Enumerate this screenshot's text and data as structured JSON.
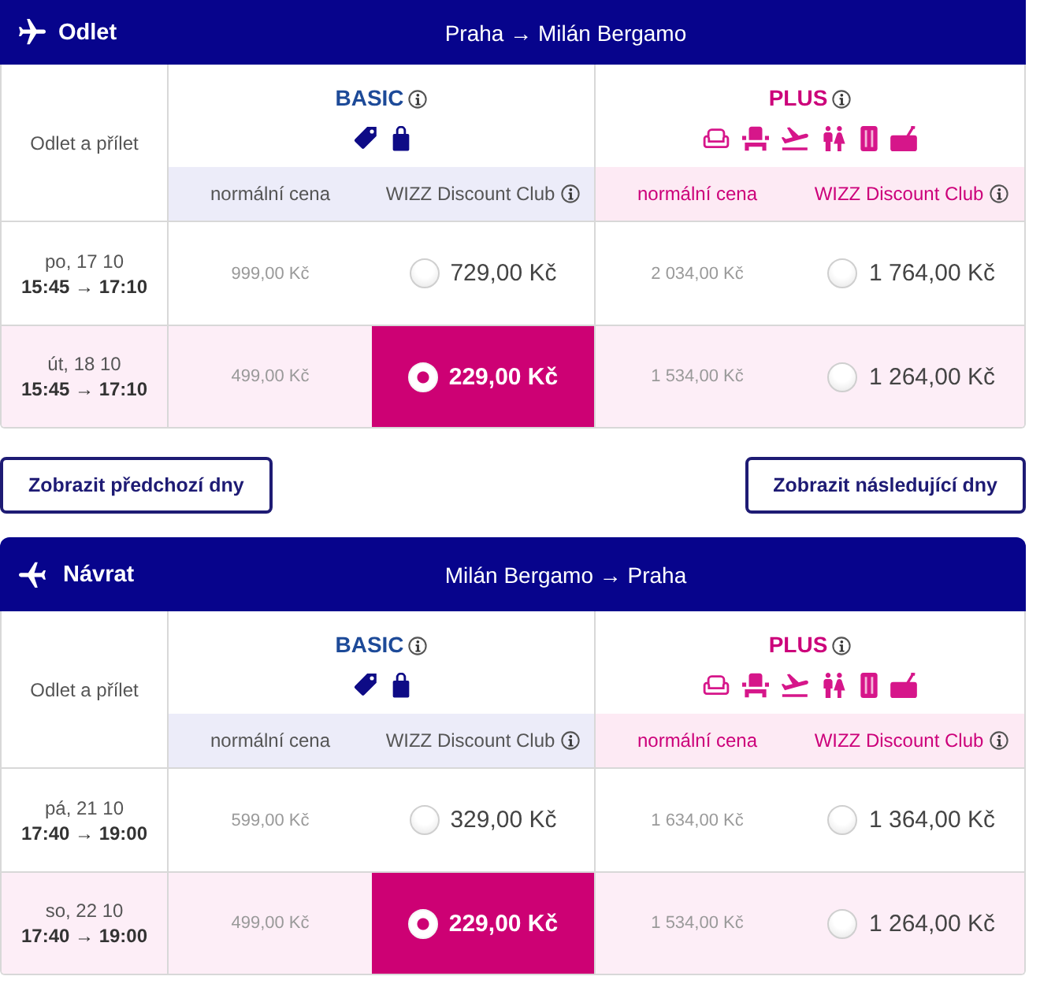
{
  "sections": [
    {
      "kind": "outbound",
      "title": "Odlet",
      "route": "Praha → Milán Bergamo",
      "time_heading": "Odlet a přílet",
      "fares": [
        {
          "kind": "basic",
          "name": "BASIC",
          "price_headings": [
            "normální cena",
            "WIZZ Discount Club"
          ]
        },
        {
          "kind": "plus",
          "name": "PLUS",
          "price_headings": [
            "normální cena",
            "WIZZ Discount Club"
          ]
        }
      ],
      "flights": [
        {
          "date": "po, 17 10",
          "times": "15:45 → 17:10",
          "selected": false,
          "prices": [
            {
              "normal": "999,00 Kč",
              "discount": "729,00 Kč",
              "selected": false
            },
            {
              "normal": "2 034,00 Kč",
              "discount": "1 764,00 Kč",
              "selected": false
            }
          ]
        },
        {
          "date": "út, 18 10",
          "times": "15:45 → 17:10",
          "selected": true,
          "prices": [
            {
              "normal": "499,00 Kč",
              "discount": "229,00 Kč",
              "selected": true
            },
            {
              "normal": "1 534,00 Kč",
              "discount": "1 264,00 Kč",
              "selected": false
            }
          ]
        }
      ],
      "nav_buttons": [
        "Zobrazit předchozí dny",
        "Zobrazit následující dny"
      ]
    },
    {
      "kind": "return",
      "title": "Návrat",
      "route": "Milán Bergamo → Praha",
      "time_heading": "Odlet a přílet",
      "fares": [
        {
          "kind": "basic",
          "name": "BASIC",
          "price_headings": [
            "normální cena",
            "WIZZ Discount Club"
          ]
        },
        {
          "kind": "plus",
          "name": "PLUS",
          "price_headings": [
            "normální cena",
            "WIZZ Discount Club"
          ]
        }
      ],
      "flights": [
        {
          "date": "pá, 21 10",
          "times": "17:40 → 19:00",
          "selected": false,
          "prices": [
            {
              "normal": "599,00 Kč",
              "discount": "329,00 Kč",
              "selected": false
            },
            {
              "normal": "1 634,00 Kč",
              "discount": "1 364,00 Kč",
              "selected": false
            }
          ]
        },
        {
          "date": "so, 22 10",
          "times": "17:40 → 19:00",
          "selected": true,
          "prices": [
            {
              "normal": "499,00 Kč",
              "discount": "229,00 Kč",
              "selected": true
            },
            {
              "normal": "1 534,00 Kč",
              "discount": "1 264,00 Kč",
              "selected": false
            }
          ]
        }
      ]
    }
  ]
}
